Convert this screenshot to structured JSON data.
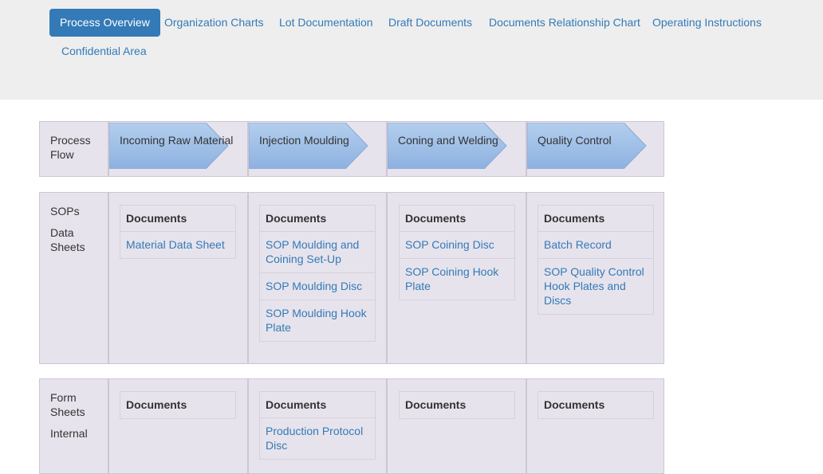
{
  "nav": {
    "items": [
      {
        "label": "Process Overview"
      },
      {
        "label": "Organization Charts"
      },
      {
        "label": "Lot Documentation"
      },
      {
        "label": "Draft Documents"
      },
      {
        "label": "Documents Relationship Chart"
      },
      {
        "label": "Operating Instructions"
      },
      {
        "label": "Confidential Area"
      }
    ],
    "active_color": "#337ab7"
  },
  "process": {
    "label_line1": "Process",
    "label_line2": "Flow",
    "steps": [
      {
        "label": "Incoming Raw Material"
      },
      {
        "label": "Injection Moulding"
      },
      {
        "label": "Coning and Welding"
      },
      {
        "label": "Quality Control"
      }
    ],
    "arrow_color": "#9dbde6"
  },
  "sops": {
    "label_line1": "SOPs",
    "label_line2": "Data",
    "label_line3": "Sheets",
    "columns": [
      {
        "heading": "Documents",
        "items": [
          "Material Data Sheet"
        ]
      },
      {
        "heading": "Documents",
        "items": [
          "SOP Moulding and Coining Set-Up",
          "SOP Moulding Disc",
          "SOP Moulding Hook Plate"
        ]
      },
      {
        "heading": "Documents",
        "items": [
          "SOP Coining Disc",
          "SOP Coining Hook Plate"
        ]
      },
      {
        "heading": "Documents",
        "items": [
          "Batch Record",
          "SOP Quality Control Hook Plates and Discs"
        ]
      }
    ]
  },
  "forms": {
    "label_line1": "Form",
    "label_line2": "Sheets",
    "label_line3": "Internal",
    "columns": [
      {
        "heading": "Documents",
        "items": []
      },
      {
        "heading": "Documents",
        "items": [
          "Production Protocol Disc"
        ]
      },
      {
        "heading": "Documents",
        "items": []
      },
      {
        "heading": "Documents",
        "items": []
      }
    ]
  }
}
